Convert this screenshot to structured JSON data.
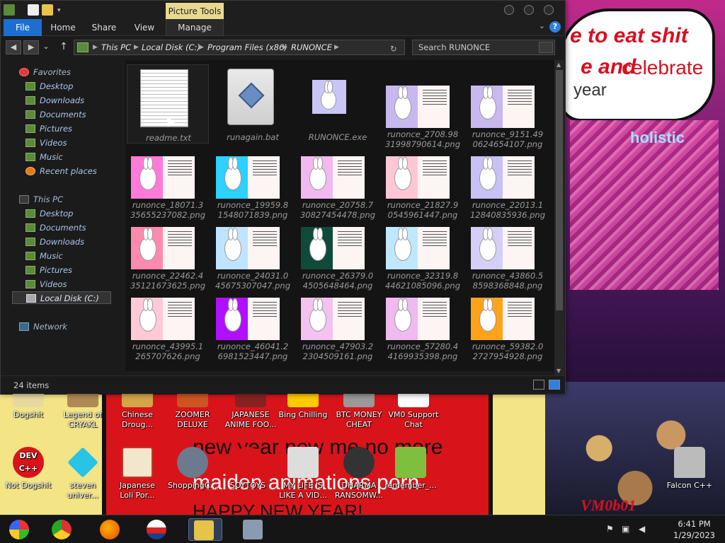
{
  "window": {
    "picture_tools_label": "Picture Tools",
    "tabs": [
      "File",
      "Home",
      "Share",
      "View",
      "Manage"
    ],
    "address_crumbs": [
      "This PC",
      "Local Disk (C:)",
      "Program Files (x86)",
      "RUNONCE"
    ],
    "search_placeholder": "Search RUNONCE",
    "status_count": "24 items",
    "help_label": "?"
  },
  "nav": {
    "favorites_header": "Favorites",
    "favorites": [
      "Desktop",
      "Downloads",
      "Documents",
      "Pictures",
      "Videos",
      "Music",
      "Recent places"
    ],
    "thispc_header": "This PC",
    "thispc": [
      "Desktop",
      "Documents",
      "Downloads",
      "Music",
      "Pictures",
      "Videos",
      "Local Disk (C:)"
    ],
    "network": "Network"
  },
  "files": [
    {
      "name": "readme.txt",
      "kind": "txt"
    },
    {
      "name": "runagain.bat",
      "kind": "bat"
    },
    {
      "name": "RUNONCE.exe",
      "kind": "exe"
    },
    {
      "name": "runonce_2708.98\n31998790614.png",
      "kind": "png",
      "bg": "#c8b8f0"
    },
    {
      "name": "runonce_9151.49\n0624654107.png",
      "kind": "png",
      "bg": "#c8b8f0"
    },
    {
      "name": "runonce_18071.3\n35655237082.png",
      "kind": "png",
      "bg": "#ff7ad9"
    },
    {
      "name": "runonce_19959.8\n1548071839.png",
      "kind": "png",
      "bg": "#2bd1ff"
    },
    {
      "name": "runonce_20758.7\n30827454478.png",
      "kind": "png",
      "bg": "#f2b8f0"
    },
    {
      "name": "runonce_21827.9\n0545961447.png",
      "kind": "png",
      "bg": "#ffc7d6"
    },
    {
      "name": "runonce_22013.1\n12840835936.png",
      "kind": "png",
      "bg": "#c7c1f5"
    },
    {
      "name": "runonce_22462.4\n35121673625.png",
      "kind": "png",
      "bg": "#ff8ab0"
    },
    {
      "name": "runonce_24031.0\n45675307047.png",
      "kind": "png",
      "bg": "#bfe4ff"
    },
    {
      "name": "runonce_26379.0\n4505648464.png",
      "kind": "png",
      "bg": "#0f4a3a"
    },
    {
      "name": "runonce_32319.8\n44621085096.png",
      "kind": "png",
      "bg": "#bfe8ff"
    },
    {
      "name": "runonce_43860.5\n8598368848.png",
      "kind": "png",
      "bg": "#d5cff7"
    },
    {
      "name": "runonce_43995.1\n265707626.png",
      "kind": "png",
      "bg": "#ffc9d8"
    },
    {
      "name": "runonce_46041.2\n6981523447.png",
      "kind": "png",
      "bg": "#b010ff"
    },
    {
      "name": "runonce_47903.2\n2304509161.png",
      "kind": "png",
      "bg": "#f3c2f0"
    },
    {
      "name": "runonce_57280.4\n4169935398.png",
      "kind": "png",
      "bg": "#f0b9ef"
    },
    {
      "name": "runonce_59382.0\n2727954928.png",
      "kind": "png",
      "bg": "#ffa31a"
    }
  ],
  "desktop_icons": [
    {
      "label": "Dogshit",
      "color": "#e8d9a0"
    },
    {
      "label": "Legend of\nCRYAKL",
      "color": "#b08a55"
    },
    {
      "label": "Chinese\nDroug...",
      "color": "#d4a64a"
    },
    {
      "label": "ZOOMER\nDELUXE",
      "color": "#cc5522"
    },
    {
      "label": "JAPANESE\nANIME FOO...",
      "color": "#882222"
    },
    {
      "label": "Bing Chilling",
      "color": "#ffcc00"
    },
    {
      "label": "BTC MONEY\nCHEAT",
      "color": "#999999"
    },
    {
      "label": "VM0 Support\nChat",
      "color": "#ffffff"
    },
    {
      "label": "Not Dogshit",
      "color": "#d8141a",
      "badge": "DEV C++"
    },
    {
      "label": "steven\nuniver...",
      "color": "#27c4e6"
    },
    {
      "label": "Japanese\nLoli Por...",
      "color": "#f2e6cc"
    },
    {
      "label": "ShoppingC...",
      "color": "#6b7a8f"
    },
    {
      "label": "SOYTOYS",
      "color": "#d8141a"
    },
    {
      "label": "MY LIFE IS\nLIKE A VID...",
      "color": "#dddddd"
    },
    {
      "label": "DHARMA\nRANSOMW...",
      "color": "#333333"
    },
    {
      "label": "remember_...",
      "color": "#7fbf3f"
    },
    {
      "label": "Falcon C++",
      "color": "#bbbbbb"
    }
  ],
  "wallpaper_text": {
    "line1": "e to eat shit",
    "line2": "e and",
    "line2b": "celebrate",
    "line3": "year",
    "neon": "holistic",
    "bottom1": "new year new me no more",
    "bottom2": "maiden animations porn",
    "bottom3": "HAPPY NEW YEAR!",
    "vm": "VM0b01"
  },
  "clock": {
    "time": "6:41 PM",
    "date": "1/29/2023"
  }
}
